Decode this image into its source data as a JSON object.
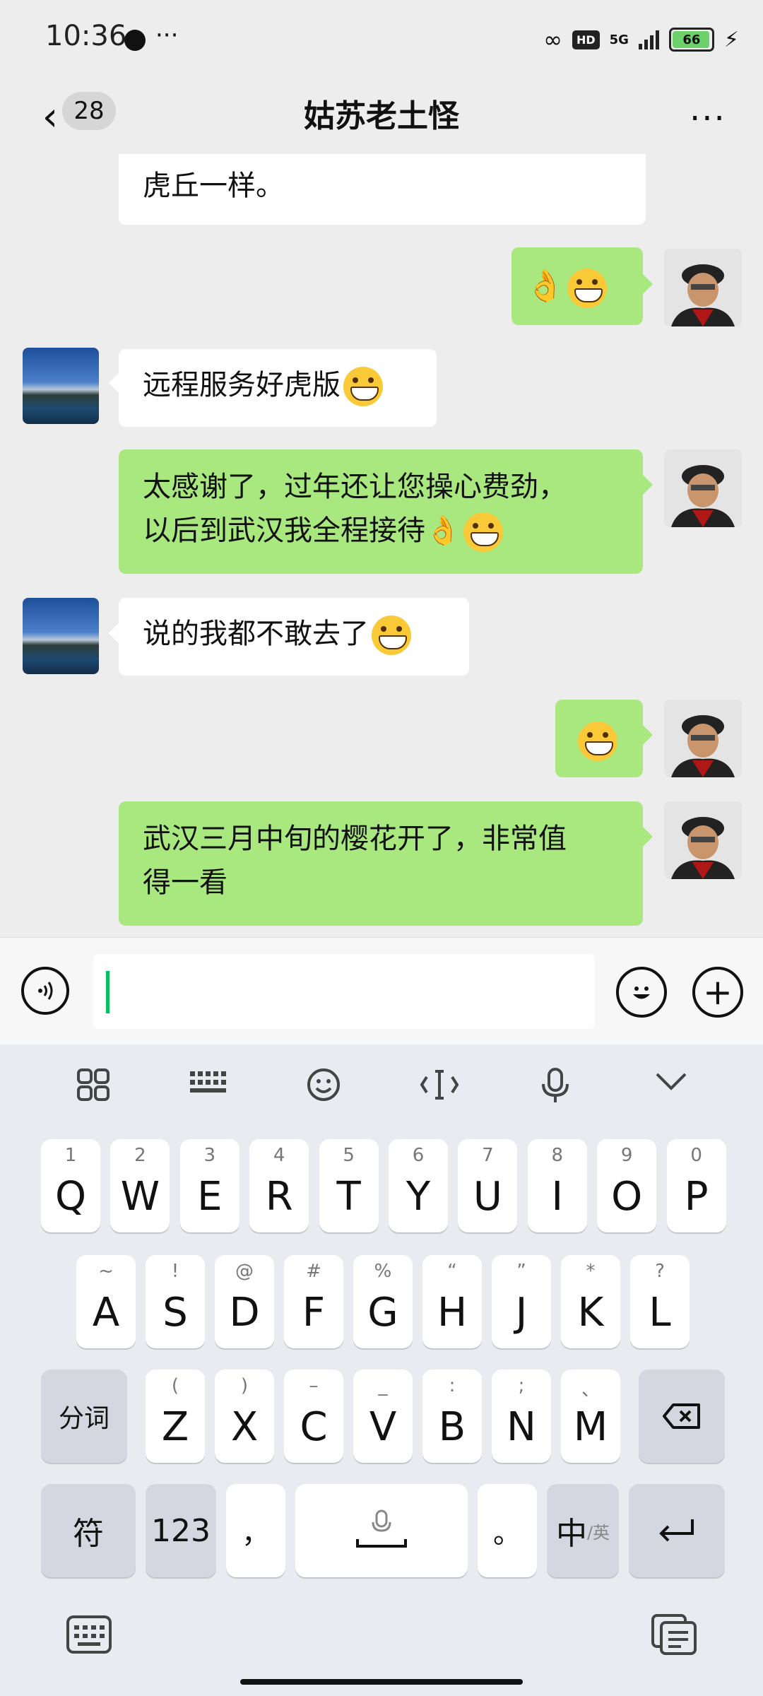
{
  "status_bar": {
    "time": "10:36",
    "more": "···",
    "hd": "HD",
    "network": "5G",
    "battery": "66"
  },
  "header": {
    "back_count": "28",
    "title": "姑苏老土怪",
    "more": "···"
  },
  "messages": [
    {
      "side": "left",
      "text": "虎丘一样。"
    },
    {
      "side": "right",
      "text": "👌"
    },
    {
      "side": "left",
      "text": "远程服务好虎版"
    },
    {
      "side": "right",
      "line1": "太感谢了，过年还让您操心费劲，",
      "line2": "以后到武汉我全程接待👌"
    },
    {
      "side": "left",
      "text": "说的我都不敢去了"
    },
    {
      "side": "right",
      "text": ""
    },
    {
      "side": "right",
      "line1": "武汉三月中旬的樱花开了，非常值",
      "line2": "得一看"
    }
  ],
  "keyboard": {
    "row1": [
      {
        "k": "Q",
        "n": "1"
      },
      {
        "k": "W",
        "n": "2"
      },
      {
        "k": "E",
        "n": "3"
      },
      {
        "k": "R",
        "n": "4"
      },
      {
        "k": "T",
        "n": "5"
      },
      {
        "k": "Y",
        "n": "6"
      },
      {
        "k": "U",
        "n": "7"
      },
      {
        "k": "I",
        "n": "8"
      },
      {
        "k": "O",
        "n": "9"
      },
      {
        "k": "P",
        "n": "0"
      }
    ],
    "row2": [
      {
        "k": "A",
        "n": "~"
      },
      {
        "k": "S",
        "n": "!"
      },
      {
        "k": "D",
        "n": "@"
      },
      {
        "k": "F",
        "n": "#"
      },
      {
        "k": "G",
        "n": "%"
      },
      {
        "k": "H",
        "n": "“"
      },
      {
        "k": "J",
        "n": "”"
      },
      {
        "k": "K",
        "n": "*"
      },
      {
        "k": "L",
        "n": "?"
      }
    ],
    "row3": [
      {
        "k": "Z",
        "n": "("
      },
      {
        "k": "X",
        "n": ")"
      },
      {
        "k": "C",
        "n": "–"
      },
      {
        "k": "V",
        "n": "_"
      },
      {
        "k": "B",
        "n": ":"
      },
      {
        "k": "N",
        "n": ";"
      },
      {
        "k": "M",
        "n": "、"
      }
    ],
    "fenci": "分词",
    "fu": "符",
    "num": "123",
    "comma": "，",
    "period": "。",
    "zh": "中",
    "en": "/英"
  }
}
